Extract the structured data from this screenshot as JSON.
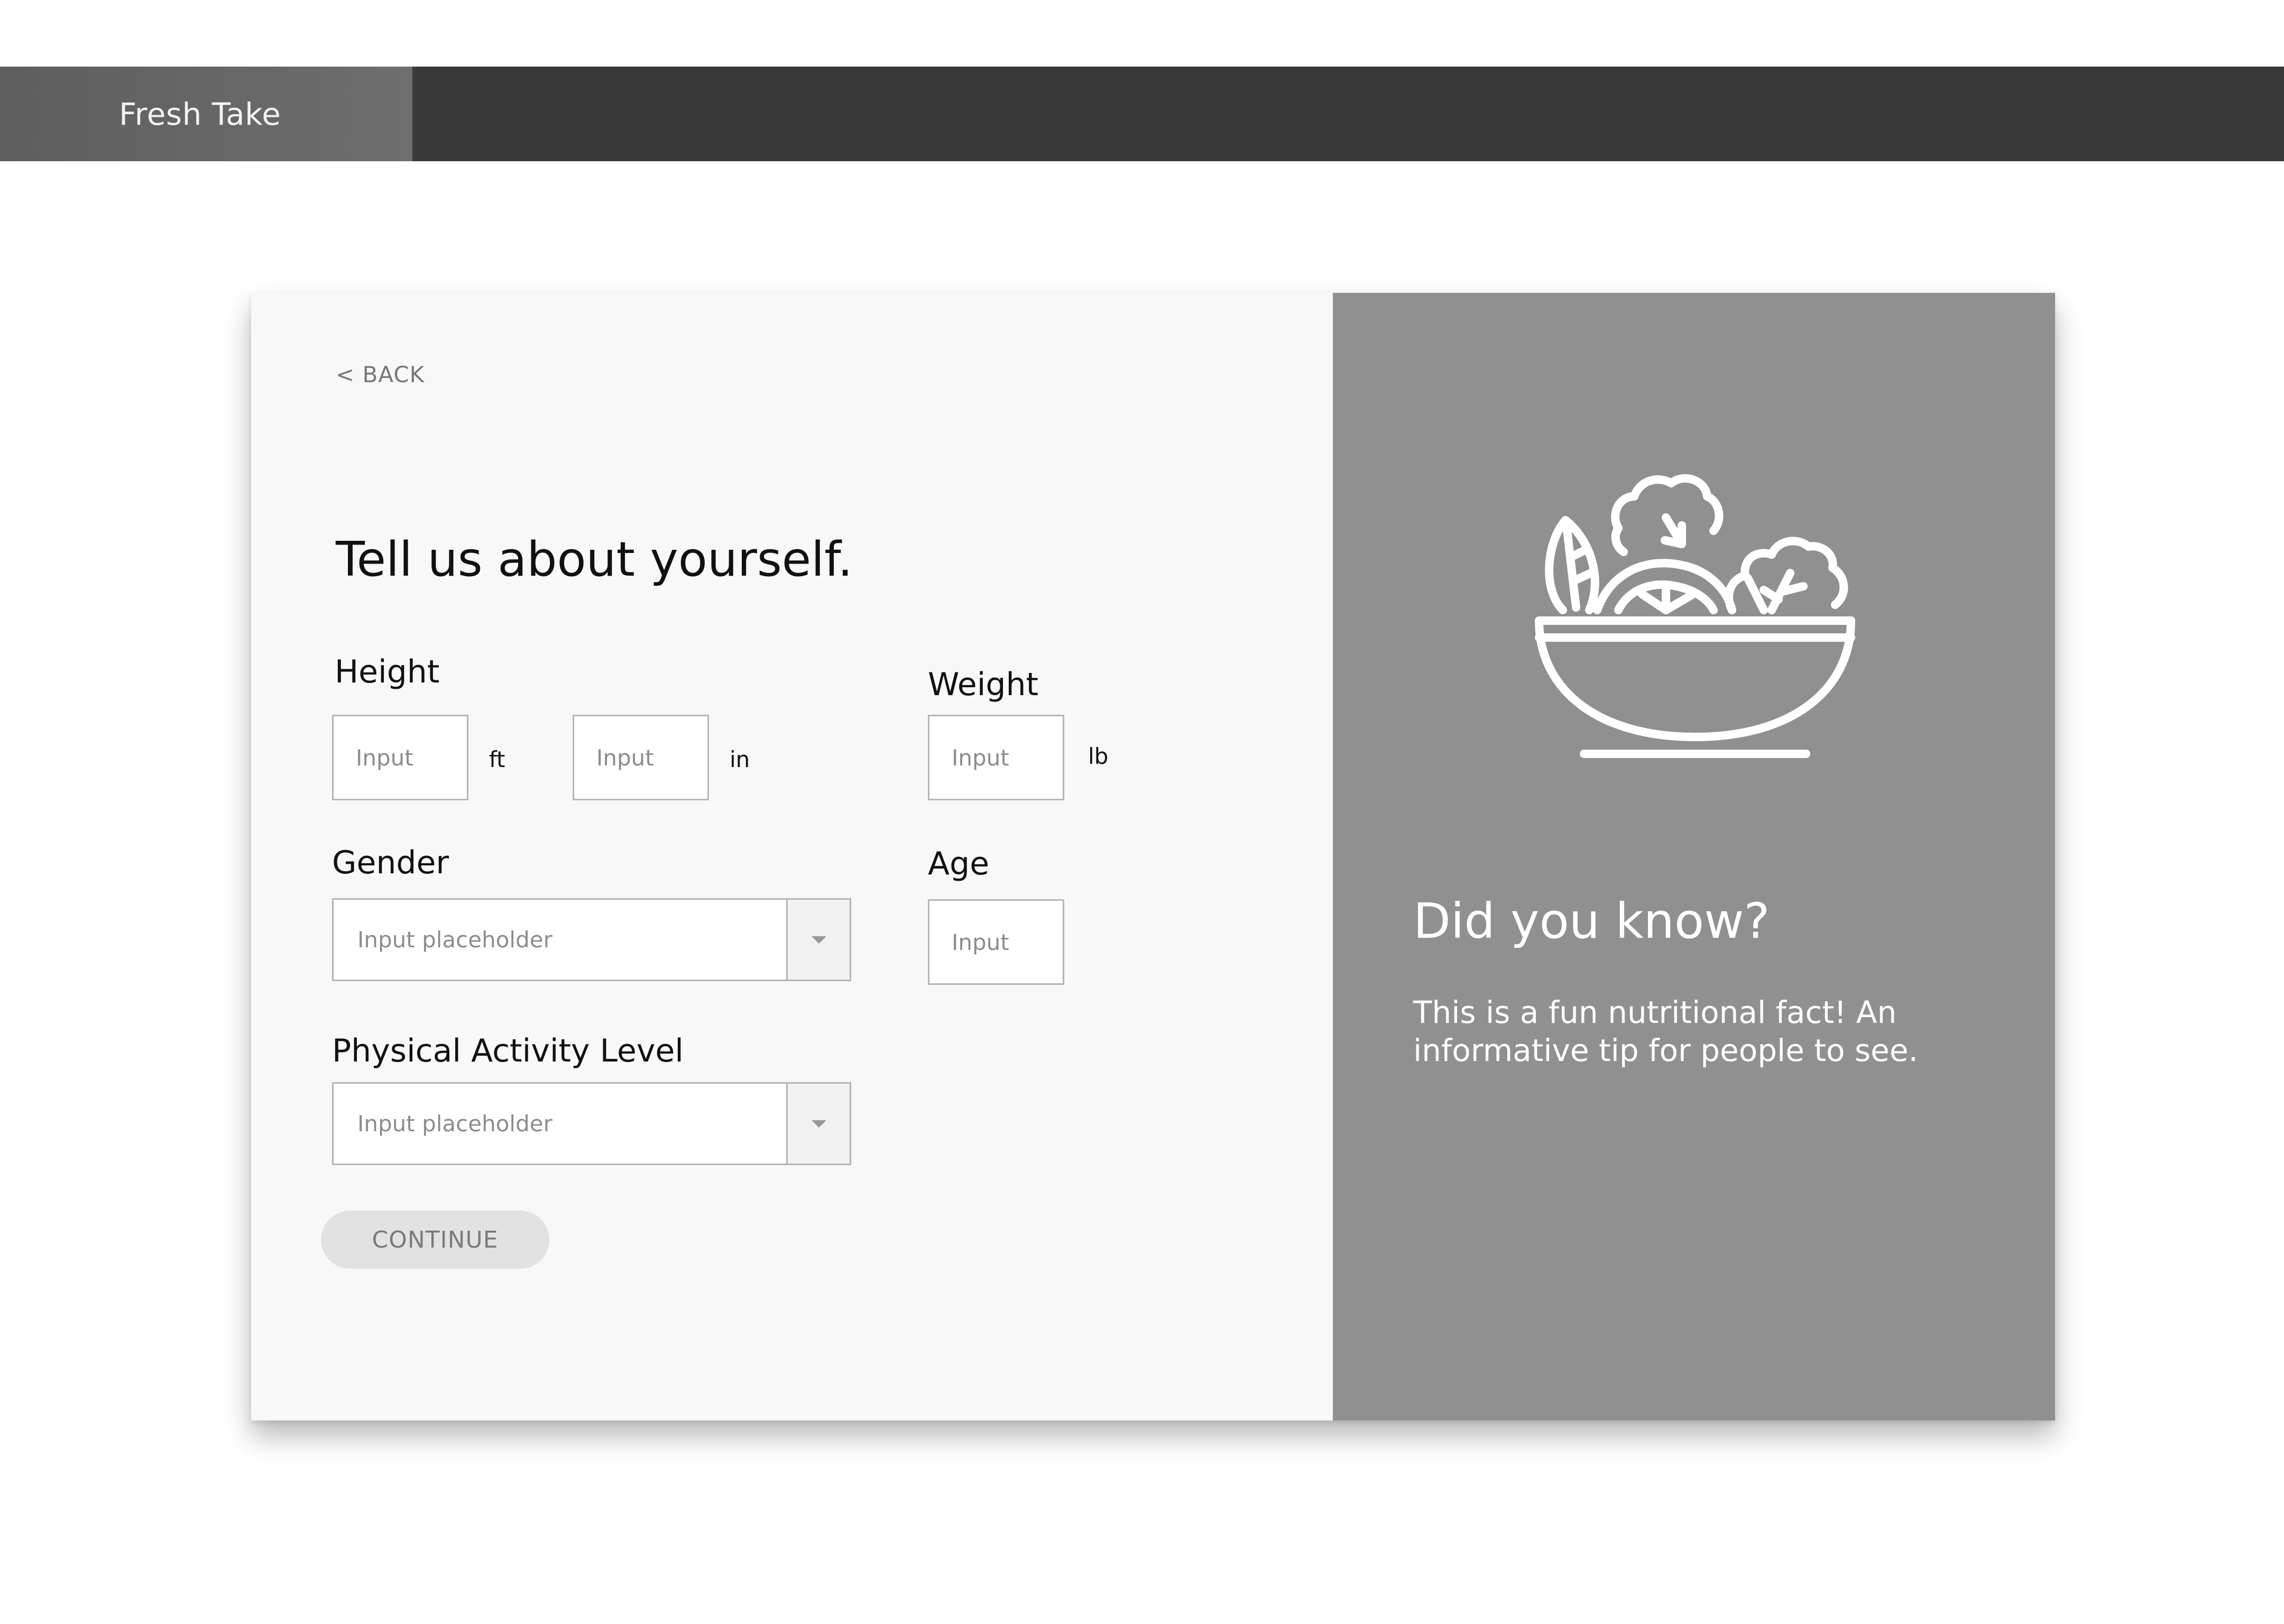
{
  "app": {
    "name": "Fresh Take"
  },
  "form": {
    "back_label": "< BACK",
    "heading": "Tell us about yourself.",
    "height": {
      "label": "Height",
      "feet_placeholder": "Input",
      "feet_unit": "ft",
      "inches_placeholder": "Input",
      "inches_unit": "in"
    },
    "weight": {
      "label": "Weight",
      "placeholder": "Input",
      "unit": "lb"
    },
    "gender": {
      "label": "Gender",
      "placeholder": "Input placeholder"
    },
    "age": {
      "label": "Age",
      "placeholder": "Input"
    },
    "activity": {
      "label": "Physical Activity Level",
      "placeholder": "Input placeholder"
    },
    "continue_label": "CONTINUE"
  },
  "info": {
    "icon": "salad-bowl-icon",
    "title": "Did you know?",
    "text": "This is a fun nutritional fact! An informative tip for people to see."
  },
  "colors": {
    "topbar": "#383838",
    "brand_tab": "#666666",
    "card": "#f8f8f8",
    "info_panel": "#909090",
    "button": "#e2e2e2"
  }
}
